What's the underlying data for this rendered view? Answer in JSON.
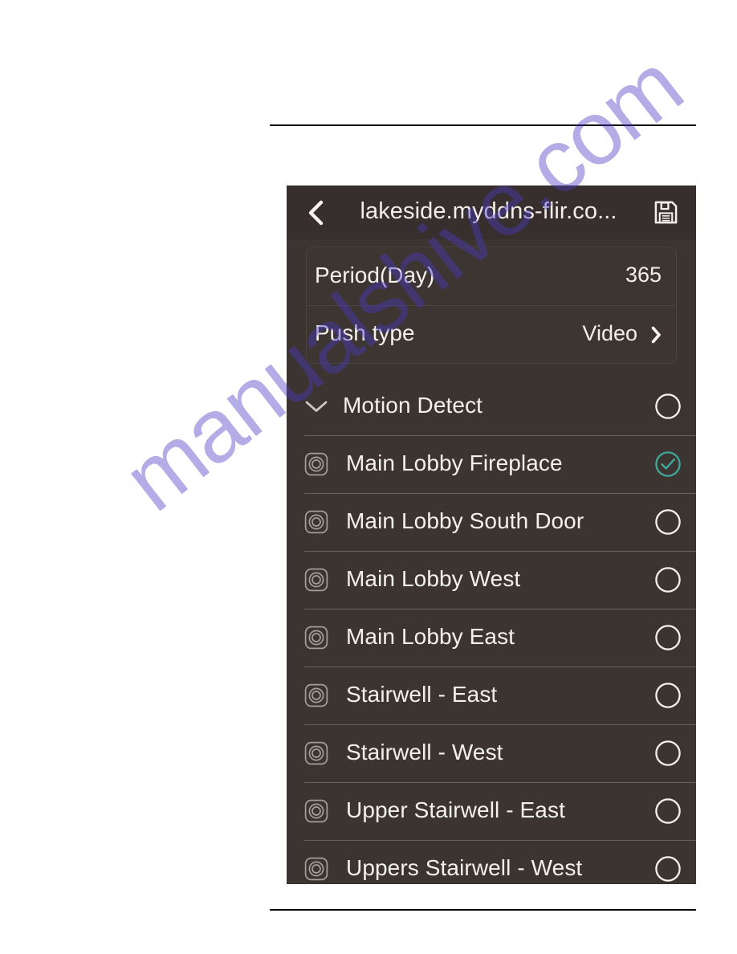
{
  "app": {
    "header": {
      "back_icon": "chevron-left-icon",
      "title": "lakeside.myddns-flir.co...",
      "save_icon": "floppy-save-icon"
    },
    "settings": [
      {
        "label": "Period(Day)",
        "value": "365",
        "has_chevron": false
      },
      {
        "label": "Push type",
        "value": "Video",
        "has_chevron": true
      }
    ],
    "group": {
      "label": "Motion Detect",
      "expanded": true,
      "collapse_icon": "chevron-down-icon",
      "selected": false
    },
    "devices": [
      {
        "label": "Main Lobby Fireplace",
        "icon": "camera-lens-icon",
        "selected": true
      },
      {
        "label": "Main Lobby South Door",
        "icon": "camera-lens-icon",
        "selected": false
      },
      {
        "label": "Main Lobby West",
        "icon": "camera-lens-icon",
        "selected": false
      },
      {
        "label": "Main Lobby East",
        "icon": "camera-lens-icon",
        "selected": false
      },
      {
        "label": "Stairwell - East",
        "icon": "camera-lens-icon",
        "selected": false
      },
      {
        "label": "Stairwell - West",
        "icon": "camera-lens-icon",
        "selected": false
      },
      {
        "label": "Upper Stairwell - East",
        "icon": "camera-lens-icon",
        "selected": false
      },
      {
        "label": "Uppers Stairwell - West",
        "icon": "camera-lens-icon",
        "selected": false
      }
    ]
  },
  "watermark": {
    "text": "manualshive.com"
  },
  "colors": {
    "panel_bg": "#3b3431",
    "header_bg": "#372f2d",
    "card_bg": "#3d3532",
    "divider": "#6b6260",
    "text": "#f3f0ee",
    "accent_selected": "#3fa89a",
    "watermark": "#4a3ac4"
  }
}
